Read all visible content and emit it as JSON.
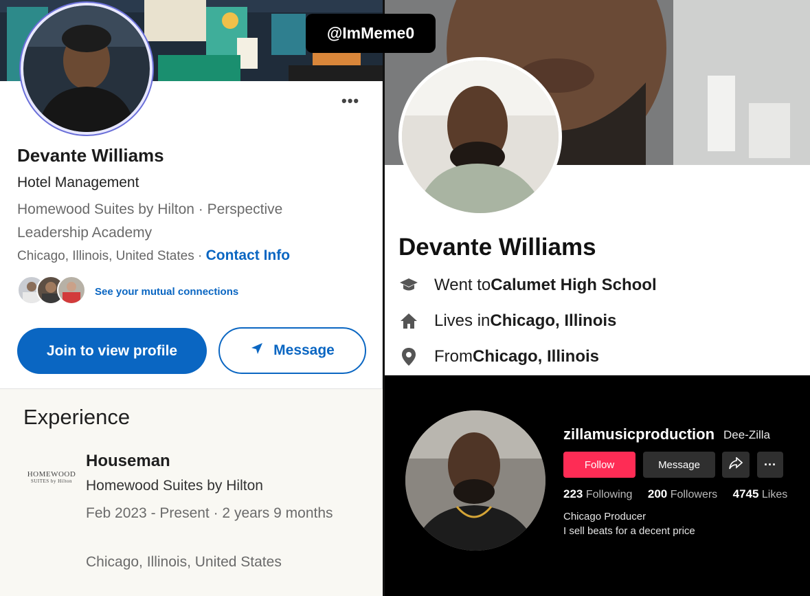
{
  "watermark": "@ImMeme0",
  "linkedin": {
    "more": "•••",
    "name": "Devante Williams",
    "headline": "Hotel Management",
    "company_line": "Homewood Suites by Hilton  ·  Perspective Leadership Academy",
    "location": "Chicago, Illinois, United States",
    "location_sep": " · ",
    "contact_info": "Contact Info",
    "mutual": "See your mutual connections",
    "join_button": "Join to view profile",
    "message_button": "Message",
    "experience_title": "Experience",
    "experience": {
      "logo_line1": "HOMEWOOD",
      "logo_line2": "SUITES by Hilton",
      "title": "Houseman",
      "company": "Homewood Suites by Hilton",
      "dates": "Feb 2023 - Present  · 2 years 9 months",
      "location": "Chicago, Illinois, United States"
    }
  },
  "facebook": {
    "name": "Devante Williams",
    "rows": [
      {
        "icon": "graduation-cap-icon",
        "prefix": "Went to ",
        "bold": "Calumet High School"
      },
      {
        "icon": "home-icon",
        "prefix": "Lives in ",
        "bold": "Chicago, Illinois"
      },
      {
        "icon": "location-pin-icon",
        "prefix": "From ",
        "bold": "Chicago, Illinois"
      }
    ]
  },
  "tiktok": {
    "username": "zillamusicproduction",
    "nickname": "Dee-Zilla",
    "follow": "Follow",
    "message": "Message",
    "more": "···",
    "following_count": "223",
    "following_label": "Following",
    "followers_count": "200",
    "followers_label": "Followers",
    "likes_count": "4745",
    "likes_label": "Likes",
    "bio_line1": "Chicago Producer",
    "bio_line2": "I sell beats for a decent price"
  },
  "colors": {
    "linkedin_blue": "#0a66c2",
    "tiktok_red": "#fe2c55"
  }
}
